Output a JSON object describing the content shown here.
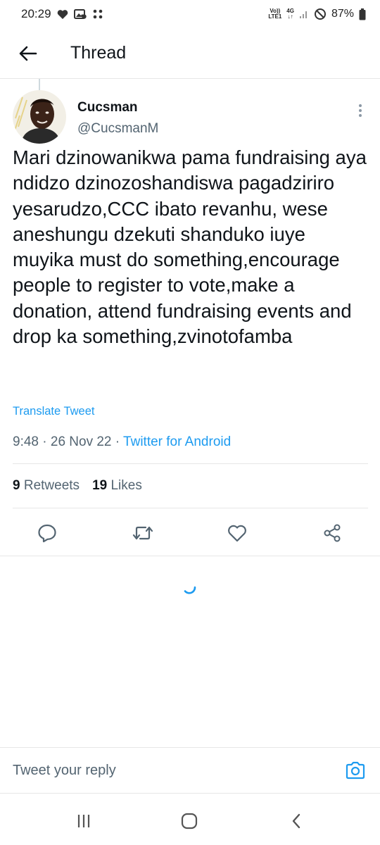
{
  "status_bar": {
    "time": "20:29",
    "network_top": "Vo))",
    "network_bottom": "LTE1",
    "data_type": "4G",
    "data_arrows": "↓↑",
    "battery_percent": "87%",
    "icons": [
      "heart-icon",
      "image-notification-icon",
      "dots-grid-icon",
      "signal-icon",
      "do-not-disturb-icon",
      "battery-icon"
    ]
  },
  "header": {
    "title": "Thread"
  },
  "tweet": {
    "author_name": "Cucsman",
    "author_handle": "@CucsmanM",
    "text": "Mari dzinowanikwa pama fundraising aya ndidzo dzinozoshandiswa pagadziriro yesarudzo,CCC ibato revanhu, wese aneshungu dzekuti shanduko iuye muyika must do something,encourage people to register to vote,make a donation, attend fundraising events and drop ka something,zvinotofamba",
    "translate_label": "Translate Tweet",
    "time": "9:48",
    "date": "26 Nov 22",
    "source": "Twitter for Android",
    "separator": " · ",
    "retweets_count": "9",
    "retweets_label": "Retweets",
    "likes_count": "19",
    "likes_label": "Likes"
  },
  "reply": {
    "placeholder": "Tweet your reply"
  },
  "colors": {
    "accent": "#1d9bf0",
    "text_primary": "#0f1419",
    "text_secondary": "#536471",
    "divider": "#e7e7e7"
  }
}
